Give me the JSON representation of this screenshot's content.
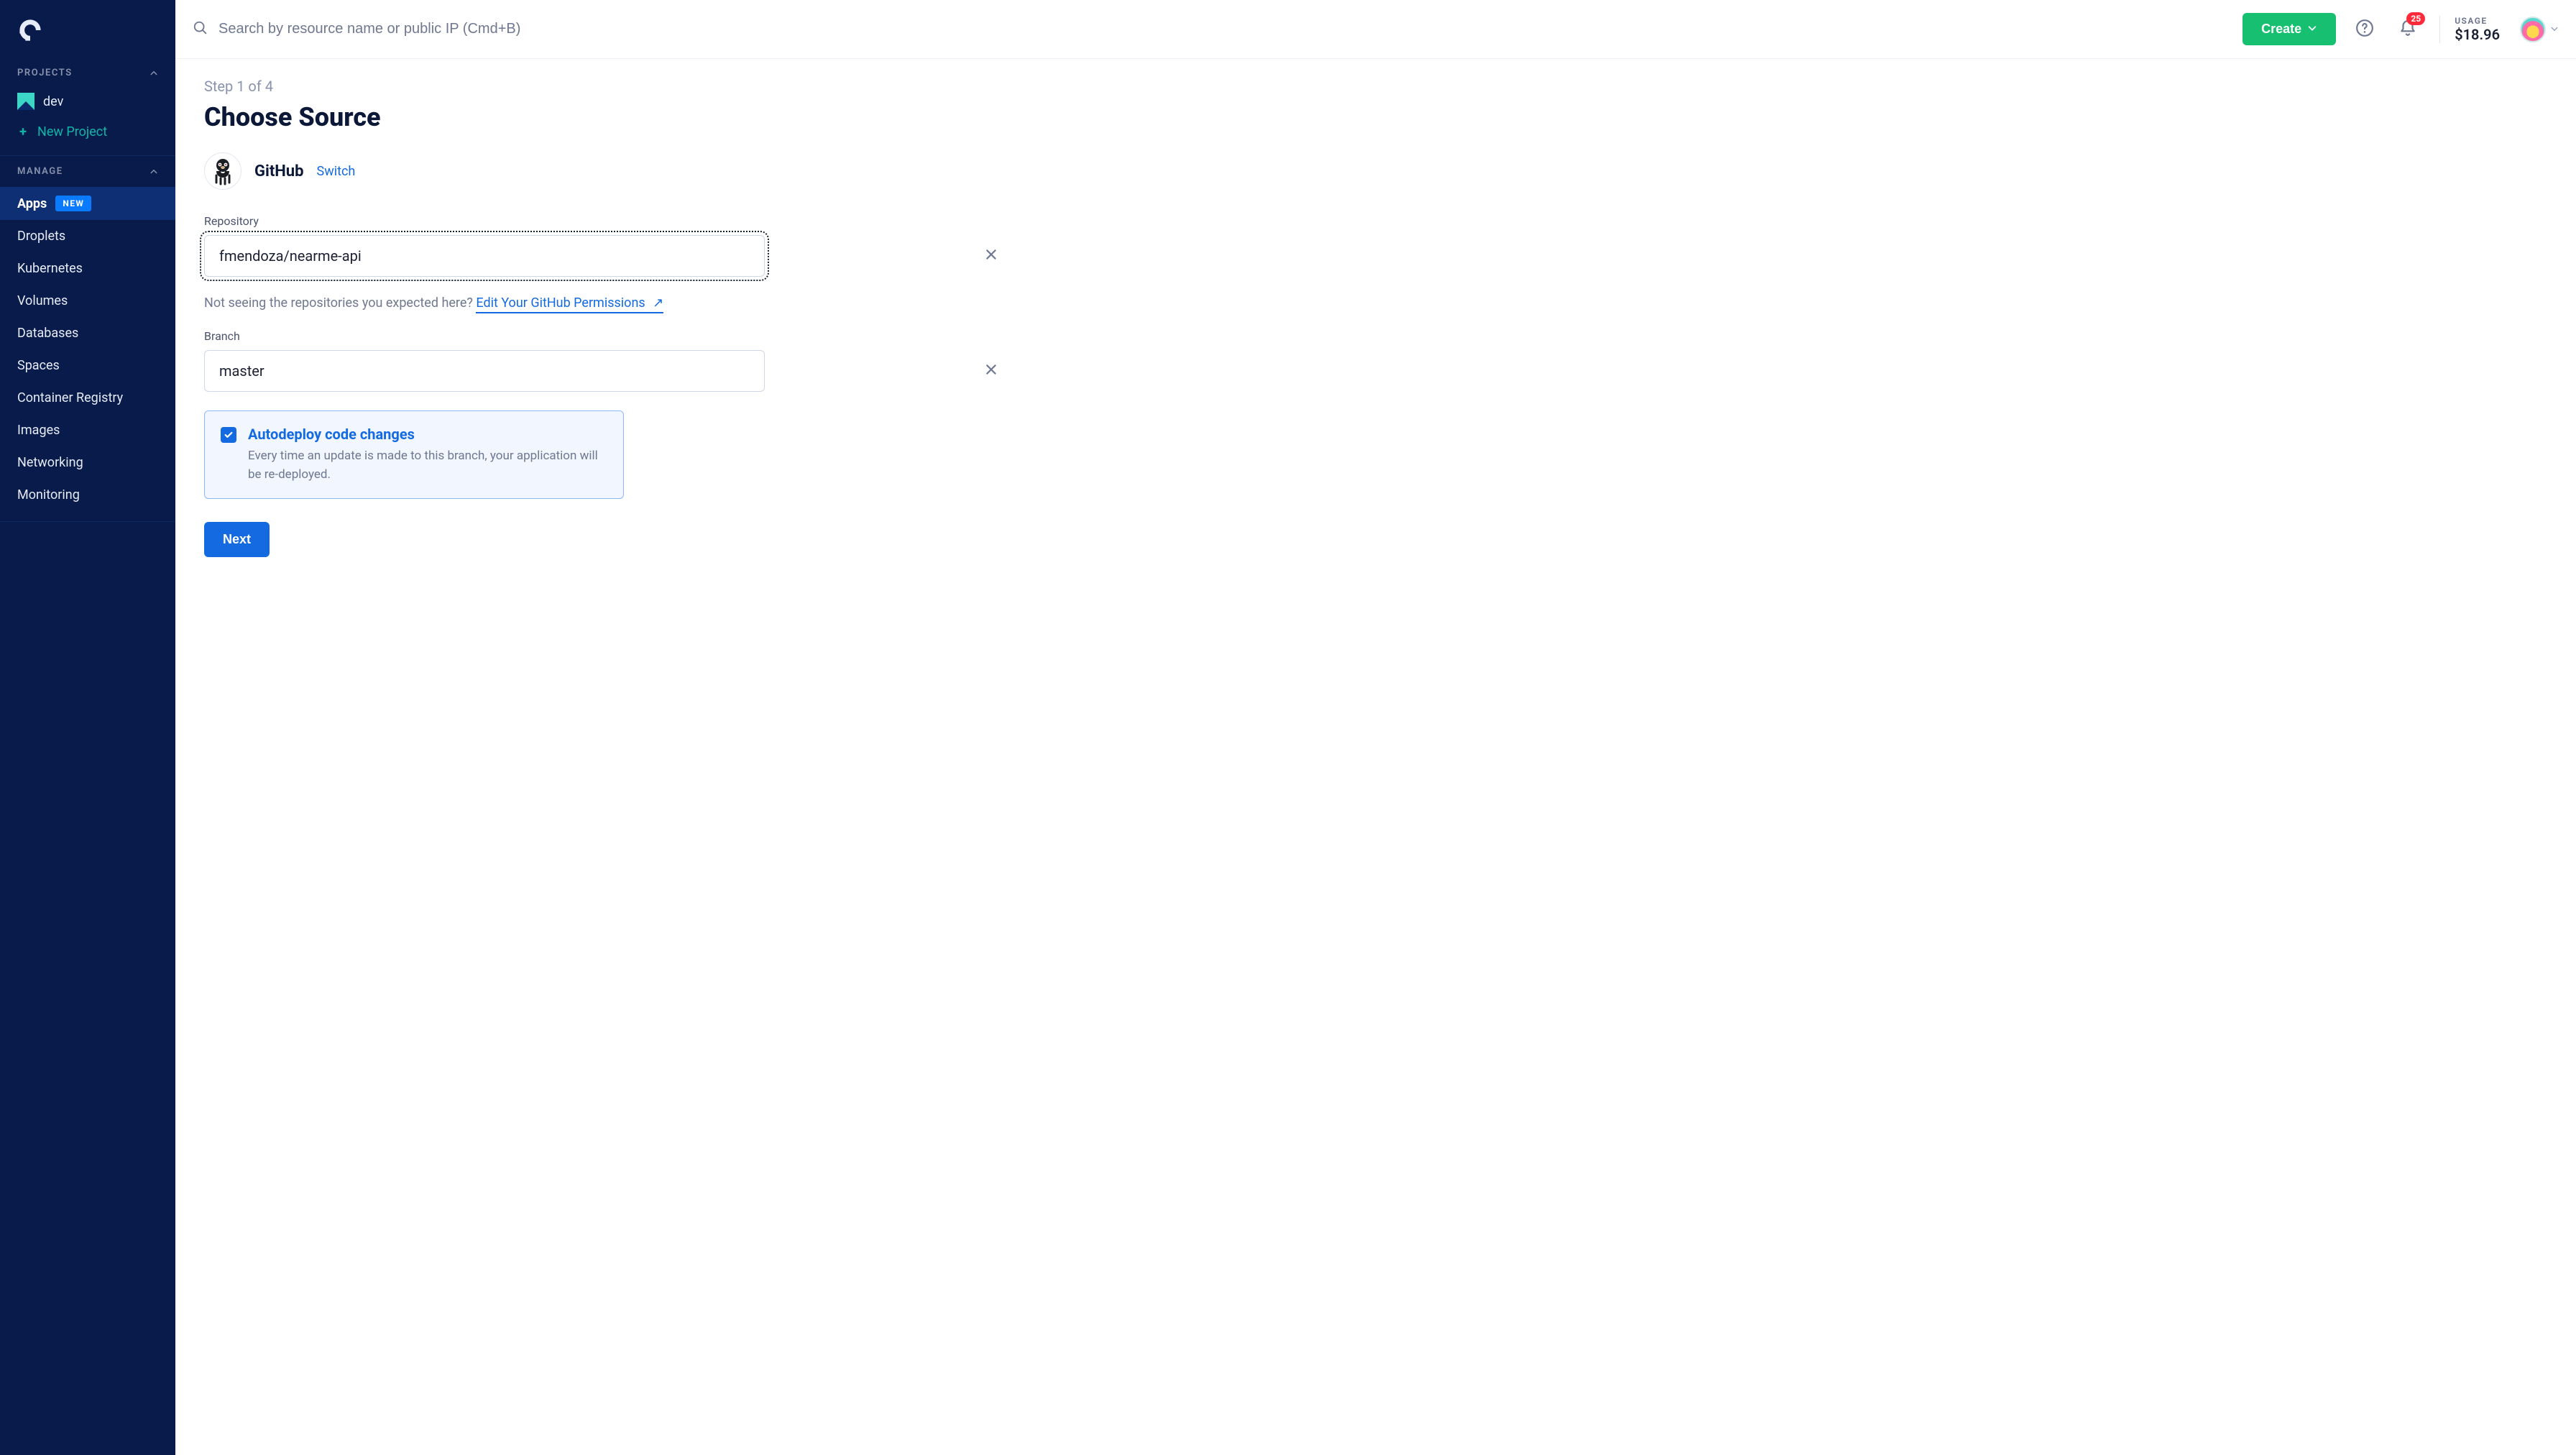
{
  "sidebar": {
    "projects_label": "PROJECTS",
    "project_name": "dev",
    "new_project_label": "New Project",
    "manage_label": "MANAGE",
    "items": [
      {
        "label": "Apps",
        "badge": "NEW",
        "active": true
      },
      {
        "label": "Droplets"
      },
      {
        "label": "Kubernetes"
      },
      {
        "label": "Volumes"
      },
      {
        "label": "Databases"
      },
      {
        "label": "Spaces"
      },
      {
        "label": "Container Registry"
      },
      {
        "label": "Images"
      },
      {
        "label": "Networking"
      },
      {
        "label": "Monitoring"
      }
    ]
  },
  "topbar": {
    "search_placeholder": "Search by resource name or public IP (Cmd+B)",
    "create_label": "Create",
    "notif_count": "25",
    "usage_label": "USAGE",
    "usage_amount": "$18.96"
  },
  "content": {
    "step_line": "Step 1 of 4",
    "title": "Choose Source",
    "source_provider": "GitHub",
    "switch_label": "Switch",
    "repo_label": "Repository",
    "repo_value": "fmendoza/nearme-api",
    "help_prefix": "Not seeing the repositories you expected here? ",
    "perm_link_label": "Edit Your GitHub Permissions",
    "branch_label": "Branch",
    "branch_value": "master",
    "autodeploy_title": "Autodeploy code changes",
    "autodeploy_desc": "Every time an update is made to this branch, your application will be re-deployed.",
    "next_label": "Next"
  }
}
